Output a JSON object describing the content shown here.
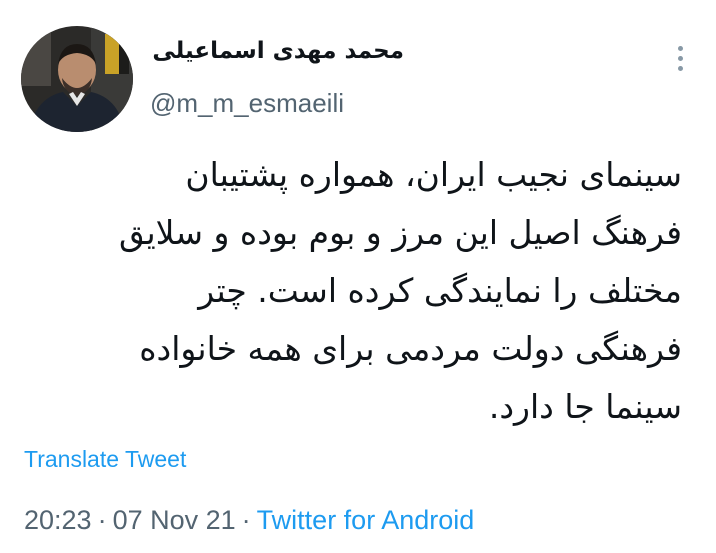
{
  "author": {
    "display_name": "محمد مهدی اسماعیلی",
    "handle": "@m_m_esmaeili"
  },
  "tweet": {
    "lines": [
      "سینمای نجیب ایران، همواره پشتیبان",
      "فرهنگ اصیل این مرز و بوم بوده و سلایق",
      "مختلف را نمایندگی کرده است. چتر",
      "فرهنگی دولت مردمی برای همه خانواده",
      "سینما جا دارد."
    ],
    "translate_label": "Translate Tweet"
  },
  "meta": {
    "time": "20:23",
    "separator": "·",
    "date": "07 Nov 21",
    "source": "Twitter for Android"
  },
  "icons": {
    "more": "more-vertical-icon"
  },
  "colors": {
    "link": "#1d9bf0",
    "secondary_text": "#536471",
    "primary_text": "#0f1419"
  }
}
